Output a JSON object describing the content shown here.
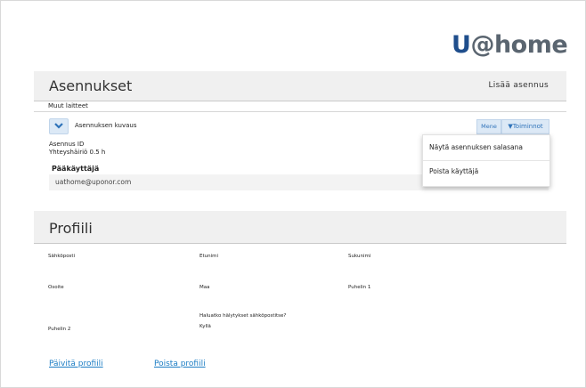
{
  "logo": {
    "u": "U",
    "rest": "@home"
  },
  "installations": {
    "title": "Asennukset",
    "add_label": "Lisää asennus",
    "other_devices": "Muut laitteet",
    "description_label": "Asennuksen kuvaus",
    "go_button": "Mene",
    "actions_button": "▼Toiminnot",
    "id_label": "Asennus ID",
    "status": "Yhteyshäiriö 0.5 h",
    "admin_label": "Pääkäyttäjä",
    "admin_email": "uathome@uponor.com",
    "menu": [
      "Näytä asennuksen salasana",
      "Poista käyttäjä"
    ]
  },
  "profile": {
    "title": "Profiili",
    "fields": {
      "email": "Sähköposti",
      "first_name": "Etunimi",
      "last_name": "Sukunimi",
      "address": "Osoite",
      "country": "Maa",
      "phone1": "Puhelin 1",
      "alerts_question": "Haluatko hälytykset sähköpostitse?",
      "alerts_value": "Kyllä",
      "phone2": "Puhelin 2"
    },
    "update_link": "Päivitä profiili",
    "delete_link": "Poista profiili"
  }
}
